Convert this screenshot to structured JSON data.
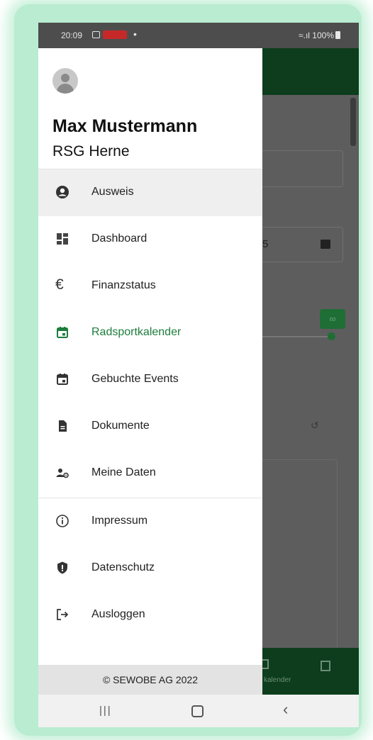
{
  "status_bar": {
    "time": "20:09",
    "battery": "100%"
  },
  "user": {
    "name": "Max Mustermann",
    "club": "RSG Herne"
  },
  "menu": {
    "items": [
      {
        "label": "Ausweis",
        "icon": "account-circle-icon",
        "state": "highlighted"
      },
      {
        "label": "Dashboard",
        "icon": "dashboard-icon"
      },
      {
        "label": "Finanzstatus",
        "icon": "euro-icon"
      },
      {
        "label": "Radsportkalender",
        "icon": "calendar-icon",
        "state": "current",
        "color": "#1e7d3c"
      },
      {
        "label": "Gebuchte Events",
        "icon": "calendar-event-icon"
      },
      {
        "label": "Dokumente",
        "icon": "document-icon"
      },
      {
        "label": "Meine Daten",
        "icon": "user-settings-icon"
      }
    ],
    "secondary": [
      {
        "label": "Impressum",
        "icon": "info-icon"
      },
      {
        "label": "Datenschutz",
        "icon": "shield-icon"
      },
      {
        "label": "Ausloggen",
        "icon": "logout-icon"
      }
    ]
  },
  "footer": {
    "copyright": "© SEWOBE AG 2022"
  },
  "background_app": {
    "field_fragment": "5",
    "badge_text": "∞",
    "bottom_nav_label": "kalender"
  },
  "colors": {
    "accent_green": "#1e7d3c",
    "header_green": "#0d3d1c",
    "glow": "#b9ecd0"
  }
}
